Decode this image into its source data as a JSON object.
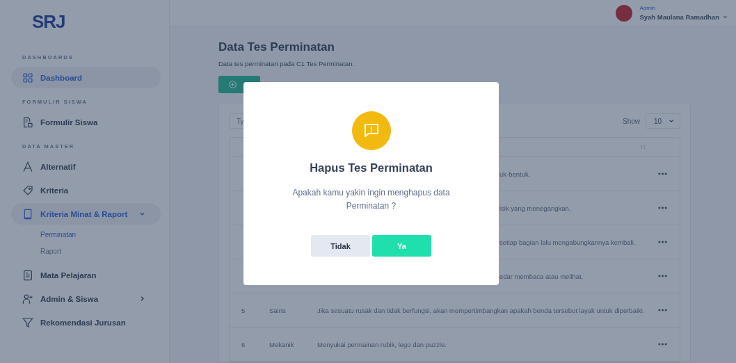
{
  "logo": "SRJ",
  "user": {
    "role": "Admin",
    "name": "Syah Maulana Ramadhan"
  },
  "sidebar": [
    {
      "kind": "section",
      "label": "DASHBOARDS"
    },
    {
      "kind": "item",
      "label": "Dashboard",
      "selected": true
    },
    {
      "kind": "section",
      "label": "FORMULIR SISWA"
    },
    {
      "kind": "item",
      "label": "Formulir Siswa",
      "selected": false
    },
    {
      "kind": "section",
      "label": "DATA MASTER"
    },
    {
      "kind": "item",
      "label": "Alternatif",
      "selected": false
    },
    {
      "kind": "item",
      "label": "Kriteria",
      "selected": false
    },
    {
      "kind": "item",
      "label": "Kriteria Minat & Raport",
      "selected": true,
      "expanded": true,
      "children": [
        {
          "label": "Perminatan",
          "selected": true
        },
        {
          "label": "Raport",
          "selected": false
        }
      ]
    },
    {
      "kind": "item",
      "label": "Mata Pelajaran",
      "selected": false
    },
    {
      "kind": "item",
      "label": "Admin & Siswa",
      "selected": false,
      "expanded": false
    },
    {
      "kind": "item",
      "label": "Rekomendasi Jurusan",
      "selected": false
    }
  ],
  "page": {
    "title": "Data Tes Perminatan",
    "subtitle": "Data tes perminatan pada C1 Tes Perminatan."
  },
  "search": {
    "placeholder": "Ty"
  },
  "show": {
    "label": "Show",
    "value": "10"
  },
  "rows": [
    {
      "covered": true,
      "description": "uk-bentuk."
    },
    {
      "covered": true,
      "description": "isik yang menegangkan."
    },
    {
      "covered": true,
      "description": "setiap bagian lalu mengabungkannya kembali."
    },
    {
      "covered": true,
      "description": "edar membaca atau melihat."
    },
    {
      "covered": false,
      "no": "5",
      "category": "Sains",
      "description": "Jika sesuatu rusak dan tidak berfungsi, akan mempertimbangkan apakah benda tersebut layak untuk diperbaiki."
    },
    {
      "covered": false,
      "no": "6",
      "category": "Mekanik",
      "description": "Menyukai permainan rubik, lego dan puzzle."
    }
  ],
  "modal": {
    "title": "Hapus Tes Perminatan",
    "message": "Apakah kamu yakin ingin menghapus data Perminatan ?",
    "buttons": [
      {
        "label": "Tidak",
        "kind": "cancel"
      },
      {
        "label": "Ya",
        "kind": "confirm"
      }
    ]
  }
}
